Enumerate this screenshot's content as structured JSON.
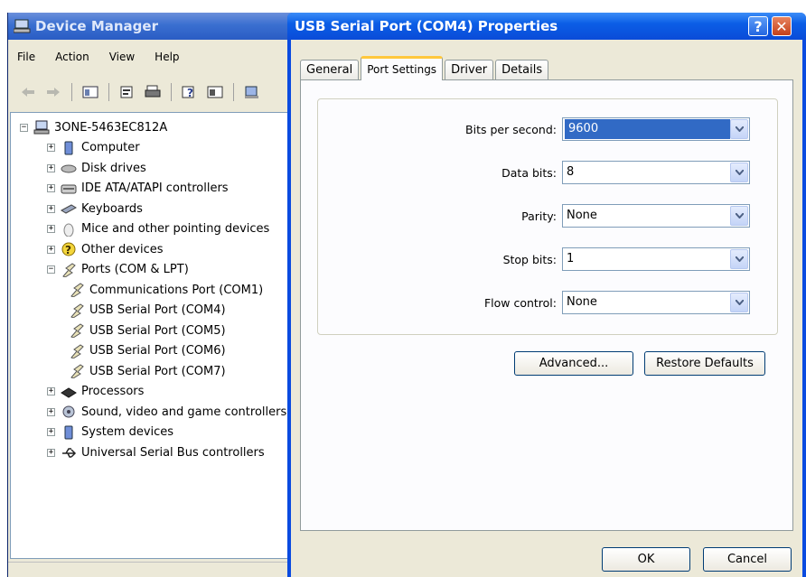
{
  "device_manager": {
    "title": "Device Manager",
    "menu": [
      "File",
      "Action",
      "View",
      "Help"
    ],
    "tree": [
      {
        "label": "3ONE-5463EC812A",
        "expander": "−",
        "icon": "computer-root-icon"
      },
      {
        "label": "Computer",
        "expander": "+",
        "icon": "computer-icon"
      },
      {
        "label": "Disk drives",
        "expander": "+",
        "icon": "disk-drive-icon"
      },
      {
        "label": "IDE ATA/ATAPI controllers",
        "expander": "+",
        "icon": "ide-controller-icon"
      },
      {
        "label": "Keyboards",
        "expander": "+",
        "icon": "keyboard-icon"
      },
      {
        "label": "Mice and other pointing devices",
        "expander": "+",
        "icon": "mouse-icon"
      },
      {
        "label": "Other devices",
        "expander": "+",
        "icon": "unknown-device-icon"
      },
      {
        "label": "Ports (COM & LPT)",
        "expander": "−",
        "icon": "port-icon"
      },
      {
        "label": "Communications Port (COM1)",
        "expander": "",
        "icon": "port-icon"
      },
      {
        "label": "USB Serial Port (COM4)",
        "expander": "",
        "icon": "port-icon"
      },
      {
        "label": "USB Serial Port (COM5)",
        "expander": "",
        "icon": "port-icon"
      },
      {
        "label": "USB Serial Port (COM6)",
        "expander": "",
        "icon": "port-icon"
      },
      {
        "label": "USB Serial Port (COM7)",
        "expander": "",
        "icon": "port-icon"
      },
      {
        "label": "Processors",
        "expander": "+",
        "icon": "processor-icon"
      },
      {
        "label": "Sound, video and game controllers",
        "expander": "+",
        "icon": "sound-icon"
      },
      {
        "label": "System devices",
        "expander": "+",
        "icon": "system-device-icon"
      },
      {
        "label": "Universal Serial Bus controllers",
        "expander": "+",
        "icon": "usb-icon"
      }
    ]
  },
  "dialog": {
    "title": "USB Serial Port (COM4) Properties",
    "help_glyph": "?",
    "close_glyph": "✕",
    "tabs": [
      "General",
      "Port Settings",
      "Driver",
      "Details"
    ],
    "active_tab": "Port Settings",
    "fields": [
      {
        "label": "Bits per second:",
        "value": "9600"
      },
      {
        "label": "Data bits:",
        "value": "8"
      },
      {
        "label": "Parity:",
        "value": "None"
      },
      {
        "label": "Stop bits:",
        "value": "1"
      },
      {
        "label": "Flow control:",
        "value": "None"
      }
    ],
    "advanced_button": "Advanced...",
    "restore_button": "Restore Defaults",
    "ok_button": "OK",
    "cancel_button": "Cancel"
  },
  "colors": {
    "title_blue": "#0a4be0",
    "selection": "#316ac5",
    "tab_highlight": "#ffc83c"
  }
}
